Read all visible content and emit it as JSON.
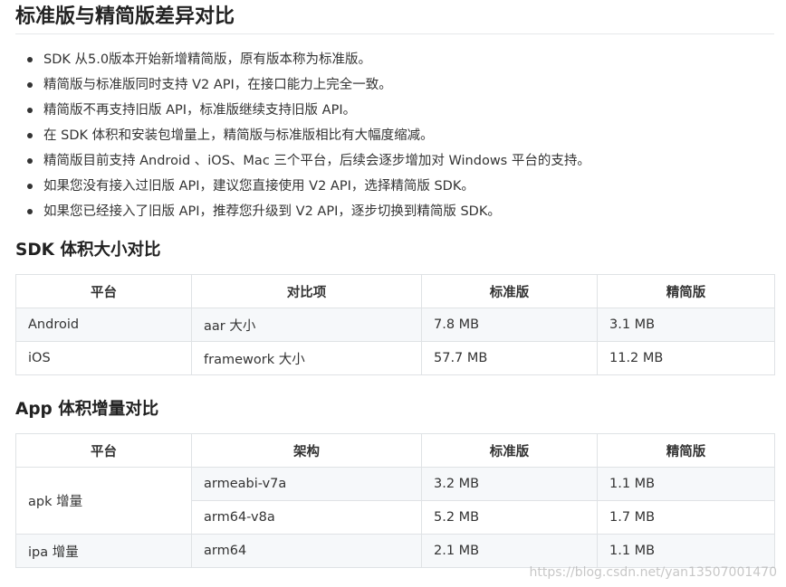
{
  "title": "标准版与精简版差异对比",
  "bullets": [
    "SDK 从5.0版本开始新增精简版，原有版本称为标准版。",
    "精简版与标准版同时支持 V2 API，在接口能力上完全一致。",
    "精简版不再支持旧版 API，标准版继续支持旧版 API。",
    "在 SDK 体积和安装包增量上，精简版与标准版相比有大幅度缩减。",
    "精简版目前支持 Android 、iOS、Mac 三个平台，后续会逐步增加对 Windows 平台的支持。",
    "如果您没有接入过旧版 API，建议您直接使用 V2 API，选择精简版 SDK。",
    "如果您已经接入了旧版 API，推荐您升级到 V2 API，逐步切换到精简版 SDK。"
  ],
  "section1": {
    "heading": "SDK 体积大小对比",
    "headers": [
      "平台",
      "对比项",
      "标准版",
      "精简版"
    ],
    "rows": [
      [
        "Android",
        "aar 大小",
        "7.8 MB",
        "3.1 MB"
      ],
      [
        "iOS",
        "framework 大小",
        "57.7 MB",
        "11.2 MB"
      ]
    ]
  },
  "section2": {
    "heading": "App 体积增量对比",
    "headers": [
      "平台",
      "架构",
      "标准版",
      "精简版"
    ],
    "rows": [
      [
        "apk 增量",
        "armeabi-v7a",
        "3.2 MB",
        "1.1 MB"
      ],
      [
        "",
        "arm64-v8a",
        "5.2 MB",
        "1.7 MB"
      ],
      [
        "ipa 增量",
        "arm64",
        "2.1 MB",
        "1.1 MB"
      ]
    ]
  },
  "watermark": "https://blog.csdn.net/yan13507001470"
}
